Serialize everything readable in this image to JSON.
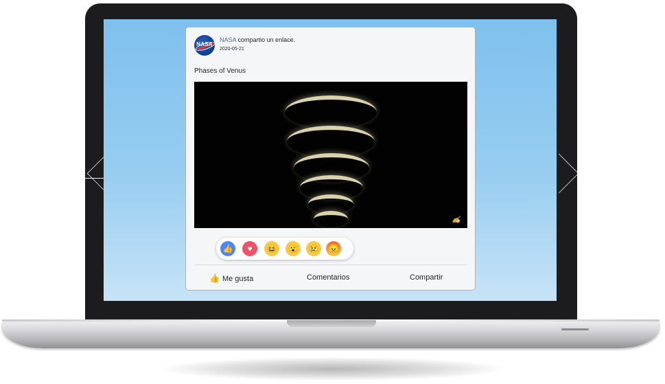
{
  "post": {
    "author": "NASA",
    "author_action": "compartio un enlace.",
    "avatar_text": "NASA",
    "date": "2020-05-21",
    "title": "Phases of Venus",
    "image_description": "Phases of Venus",
    "image_signature": "Alan Kliebbe"
  },
  "reactions": [
    {
      "name": "like",
      "glyph": "👍"
    },
    {
      "name": "love",
      "glyph": "♥"
    },
    {
      "name": "haha",
      "glyph": "😆"
    },
    {
      "name": "wow",
      "glyph": "😮"
    },
    {
      "name": "sad",
      "glyph": "😢"
    },
    {
      "name": "angry",
      "glyph": "😠"
    }
  ],
  "actions": {
    "like_label": "Me gusta",
    "like_icon": "👍",
    "comment_label": "Comentarios",
    "share_label": "Compartir"
  },
  "colors": {
    "screen_top": "#7ec0ee",
    "screen_bottom": "#c7e3f6",
    "link_blue": "#4267b2",
    "nasa_blue": "#0b3d91",
    "nasa_red": "#e03c31"
  }
}
